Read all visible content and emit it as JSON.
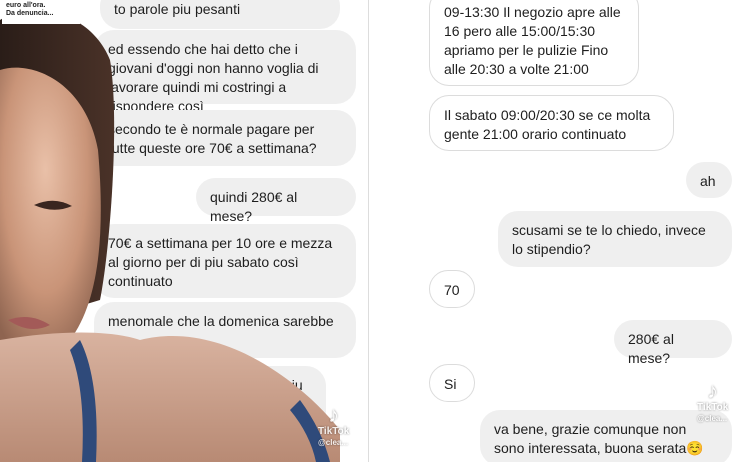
{
  "left": {
    "caption": [
      "euro all'ora.",
      "Da denuncia..."
    ],
    "messages": [
      {
        "text": "to parole piu pesanti"
      },
      {
        "text": "ed essendo che hai detto che i giovani d'oggi non hanno voglia di lavorare quindi mi costringi a rispondere così"
      },
      {
        "text": "secondo te è normale pagare per tutte queste ore 70€  a settimana?"
      },
      {
        "text": "quindi 280€ al mese?"
      },
      {
        "text": "70€ a settimana per 10 ore e mezza al giorno per di piu sabato così continuato"
      },
      {
        "text": "menomale che la domenica sarebbe di"
      },
      {
        "text": "e ci sono piu volevi la"
      }
    ],
    "watermark": {
      "brand": "TikTok",
      "user": "@clea..."
    }
  },
  "right": {
    "messages": [
      {
        "text": "09-13:30 Il negozio apre alle 16 pero alle 15:00/15:30 apriamo per le pulizie Fino alle 20:30 a volte 21:00"
      },
      {
        "text": "Il sabato 09:00/20:30 se ce molta gente 21:00 orario continuato"
      },
      {
        "text": "ah"
      },
      {
        "text": "scusami se te lo chiedo, invece lo stipendio?"
      },
      {
        "text": "70"
      },
      {
        "text": "280€ al mese?"
      },
      {
        "text": "Si"
      },
      {
        "text": "va bene, grazie comunque non sono interessata, buona serata☺️"
      }
    ],
    "watermark": {
      "brand": "TikTok",
      "user": "@clea..."
    }
  },
  "colors": {
    "bubble_gray": "#efefef",
    "bubble_border": "#dcdcdc",
    "text": "#1e1e1e"
  }
}
